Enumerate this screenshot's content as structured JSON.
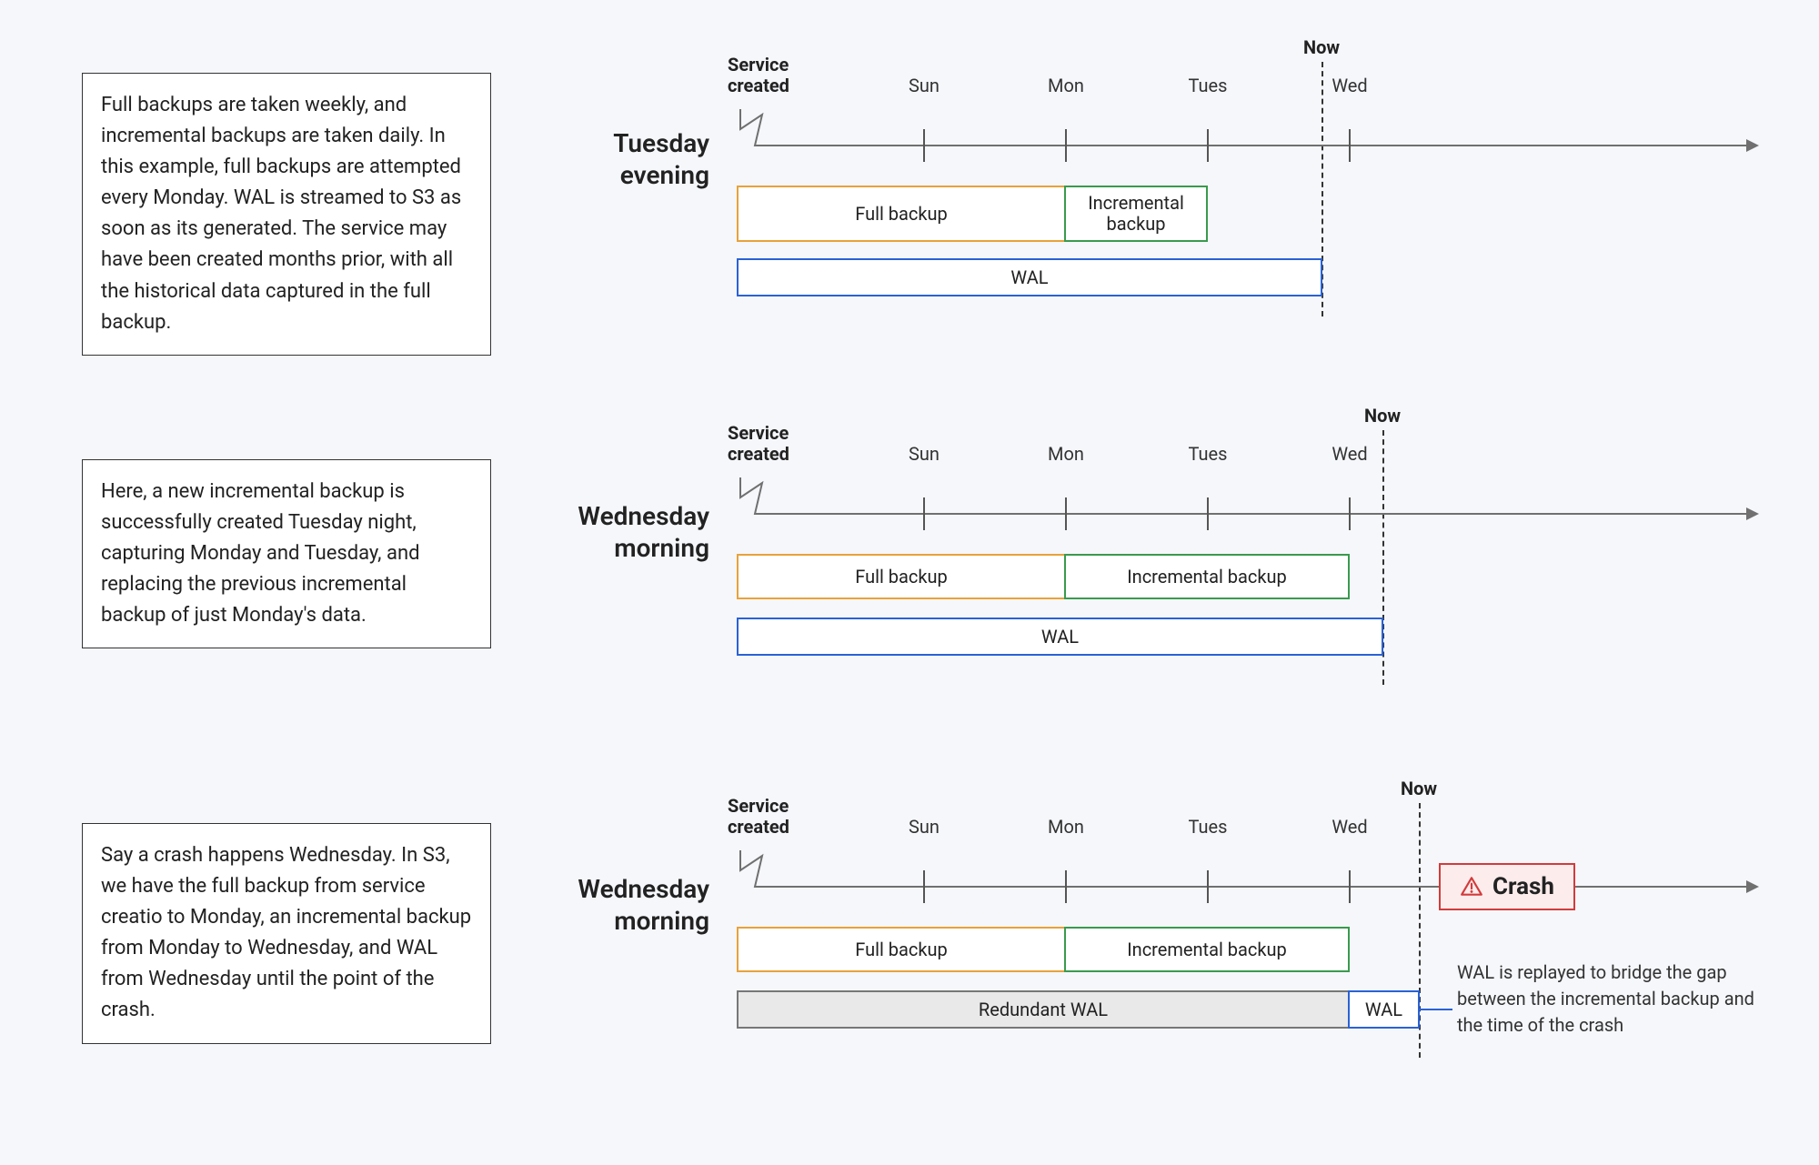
{
  "days": [
    "Sun",
    "Mon",
    "Tues",
    "Wed"
  ],
  "service_created_label": "Service\ncreated",
  "now_label": "Now",
  "rows": [
    {
      "label": "Tuesday\nevening",
      "desc": "Full backups are taken weekly, and incremental backups are taken daily. In this example, full backups are attempted every Monday. WAL is streamed to S3 as soon as its generated. The service may have been created months prior, with all the historical data captured in the full backup.",
      "full_backup_label": "Full backup",
      "incr_backup_label": "Incremental\nbackup",
      "wal_label": "WAL"
    },
    {
      "label": "Wednesday\nmorning",
      "desc": "Here, a new incremental backup is successfully  created Tuesday night, capturing Monday and Tuesday, and replacing the previous incremental backup of just Monday's data.",
      "full_backup_label": "Full backup",
      "incr_backup_label": "Incremental backup",
      "wal_label": "WAL"
    },
    {
      "label": "Wednesday\nmorning",
      "desc": "Say a crash happens Wednesday. In S3, we have the full backup from service creatio to Monday, an incremental backup from Monday to Wednesday, and WAL from Wednesday until the point of the crash.",
      "full_backup_label": "Full backup",
      "incr_backup_label": "Incremental backup",
      "redundant_wal_label": "Redundant WAL",
      "wal_label": "WAL",
      "crash_label": "Crash",
      "note": "WAL is replayed to bridge the gap between the incremental backup and the time of the crash"
    }
  ]
}
